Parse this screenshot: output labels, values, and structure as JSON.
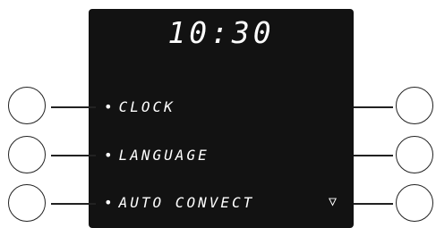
{
  "display": {
    "time": "10:30",
    "menu": [
      {
        "label": "CLOCK"
      },
      {
        "label": "LANGUAGE"
      },
      {
        "label": "AUTO CONVECT"
      }
    ],
    "bullet": "•",
    "scroll_indicator": "▽"
  },
  "icons": {
    "scroll": "down-triangle-icon"
  },
  "colors": {
    "screen": "#121212",
    "text": "#ffffff",
    "buttons": "#222222"
  }
}
